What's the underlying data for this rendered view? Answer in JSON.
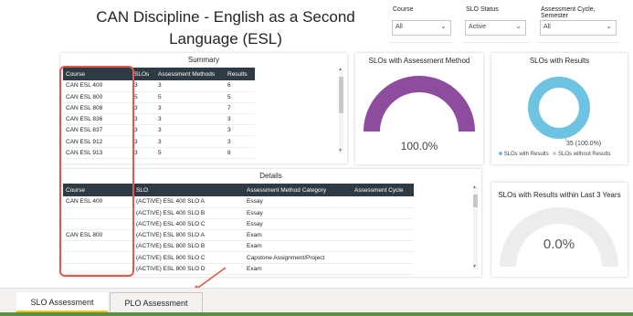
{
  "report": {
    "title": "CAN Discipline - English as a Second Language (ESL)"
  },
  "slicers": [
    {
      "label": "Course",
      "value": "All"
    },
    {
      "label": "SLO Status",
      "value": "Active"
    },
    {
      "label": "Assessment Cycle, Semester",
      "value": "All"
    }
  ],
  "summary": {
    "title": "Summary",
    "columns": [
      "Course",
      "SLOs",
      "Assessment Methods",
      "Results"
    ],
    "rows": [
      [
        "CAN ESL 400",
        "3",
        "3",
        "6"
      ],
      [
        "CAN ESL 800",
        "5",
        "5",
        "5"
      ],
      [
        "CAN ESL 808",
        "3",
        "3",
        "7"
      ],
      [
        "CAN ESL 836",
        "3",
        "3",
        "3"
      ],
      [
        "CAN ESL 837",
        "3",
        "3",
        "3"
      ],
      [
        "CAN ESL 912",
        "3",
        "3",
        "3"
      ],
      [
        "CAN ESL 913",
        "3",
        "5",
        "8"
      ]
    ]
  },
  "details": {
    "title": "Details",
    "columns": [
      "Course",
      "SLO",
      "Assessment Method Category",
      "Assessment Cycle"
    ],
    "rows": [
      [
        "CAN ESL 400",
        "(ACTIVE) ESL 400 SLO A",
        "Essay",
        ""
      ],
      [
        "",
        "(ACTIVE) ESL 400 SLO B",
        "Essay",
        ""
      ],
      [
        "",
        "(ACTIVE) ESL 400 SLO C",
        "Essay",
        ""
      ],
      [
        "CAN ESL 800",
        "(ACTIVE) ESL 800 SLO A",
        "Exam",
        ""
      ],
      [
        "",
        "(ACTIVE) ESL 800 SLO B",
        "Exam",
        ""
      ],
      [
        "",
        "(ACTIVE) ESL 800 SLO C",
        "Capstone Assignment/Project",
        ""
      ],
      [
        "",
        "(ACTIVE) ESL 800 SLO D",
        "Exam",
        ""
      ]
    ]
  },
  "gauge_assessment": {
    "title": "SLOs with Assessment Method",
    "value_label": "100.0%",
    "fraction": 1.0,
    "color": "#8e4c9e"
  },
  "donut_results": {
    "title": "SLOs with Results",
    "data_label": "35 (100.0%)",
    "fraction_with": 1.0,
    "color_with": "#6fc3e2",
    "color_without": "#e5e5e5",
    "legend": [
      {
        "label": "SLOs with Results",
        "color": "#6fc3e2"
      },
      {
        "label": "SLOs without Results",
        "color": "#cccccc"
      }
    ]
  },
  "gauge_recent": {
    "title": "SLOs with Results within Last 3 Years",
    "value_label": "0.0%",
    "fraction": 0.0
  },
  "tabs": [
    {
      "label": "SLO Assessment",
      "active": true
    },
    {
      "label": "PLO Assessment",
      "active": false
    }
  ]
}
